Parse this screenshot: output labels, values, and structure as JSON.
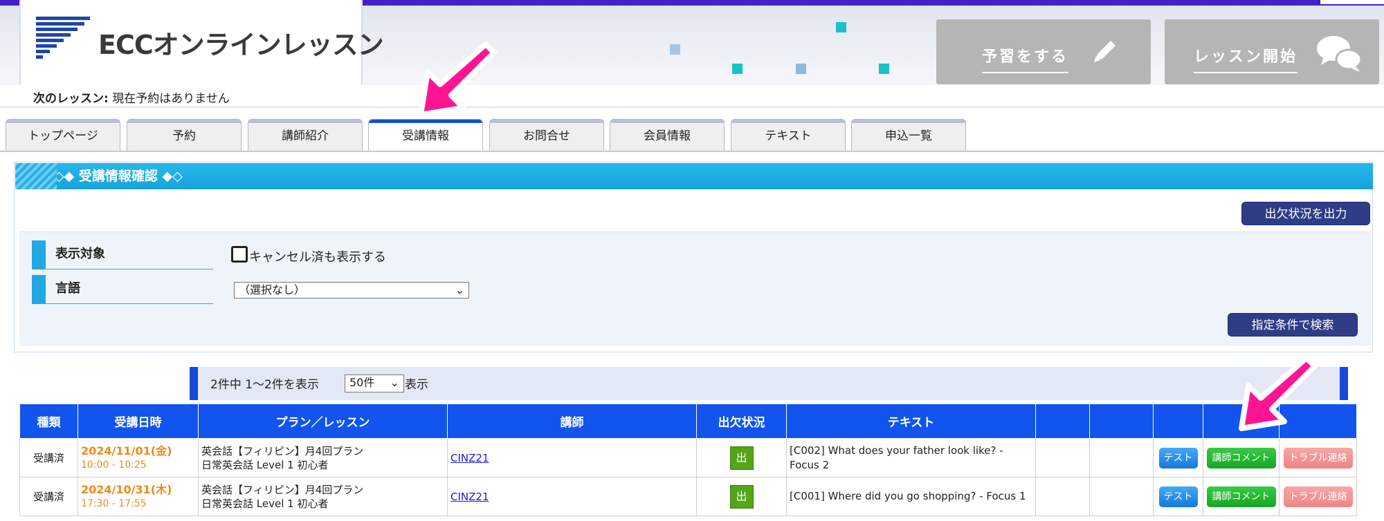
{
  "brand": {
    "logo_text": "ECCオンラインレッスン"
  },
  "header_buttons": {
    "prepare": "予習をする",
    "start": "レッスン開始"
  },
  "next_lesson": {
    "label": "次のレッスン:",
    "value": "現在予約はありません"
  },
  "tabs": [
    {
      "label": "トップページ"
    },
    {
      "label": "予約"
    },
    {
      "label": "講師紹介"
    },
    {
      "label": "受講情報"
    },
    {
      "label": "お問合せ"
    },
    {
      "label": "会員情報"
    },
    {
      "label": "テキスト"
    },
    {
      "label": "申込一覧"
    }
  ],
  "active_tab": "受講情報",
  "section": {
    "title": "◇◆ 受講情報確認 ◆◇"
  },
  "export_button": "出欠状況を出力",
  "filters": {
    "display_label": "表示対象",
    "cancel_checkbox_label": "キャンセル済も表示する",
    "cancel_checked": false,
    "language_label": "言語",
    "language_value": "（選択なし）"
  },
  "search_button": "指定条件で検索",
  "pager": {
    "summary": "2件中  1〜2件を表示",
    "per_page": "50件",
    "suffix": "表示"
  },
  "table": {
    "headers": [
      "種類",
      "受講日時",
      "プラン／レッスン",
      "講師",
      "出欠状況",
      "テキスト",
      "",
      "",
      "",
      "",
      ""
    ],
    "rows": [
      {
        "type": "受講済",
        "date": "2024/11/01(金)",
        "time": "10:00 - 10:25",
        "plan_line1": "英会話【フィリピン】月4回プラン",
        "plan_line2": "日常英会話 Level 1 初心者",
        "teacher": "CINZ21",
        "attendance": "出",
        "text": "[C002] What does your father look like? - Focus 2",
        "test_btn": "テスト",
        "comment_btn": "講師コメント",
        "trouble_btn": "トラブル連絡"
      },
      {
        "type": "受講済",
        "date": "2024/10/31(木)",
        "time": "17:30 - 17:55",
        "plan_line1": "英会話【フィリピン】月4回プラン",
        "plan_line2": "日常英会話 Level 1 初心者",
        "teacher": "CINZ21",
        "attendance": "出",
        "text": "[C001] Where did you go shopping? - Focus 1",
        "test_btn": "テスト",
        "comment_btn": "講師コメント",
        "trouble_btn": "トラブル連絡"
      }
    ]
  },
  "colors": {
    "brand_navy": "#4520c8",
    "section_blue": "#1ba8e0",
    "table_header": "#1155ee",
    "annotation_arrow": "#ff1493",
    "date_orange": "#f08a18"
  },
  "icons": [
    "pencil-icon",
    "chat-bubbles-icon",
    "chevron-down-icon"
  ]
}
